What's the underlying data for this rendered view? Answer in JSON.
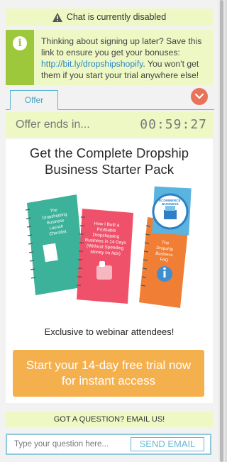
{
  "banner": {
    "text": "Chat is currently disabled",
    "icon": "warning-icon"
  },
  "notice": {
    "icon": "info-icon",
    "text_before": "Thinking about signing up later? Save this link to ensure you get your bonuses: ",
    "link": "http://bit.ly/dropshipshopify",
    "text_after": ". You won't get them if you start your trial anywhere else!"
  },
  "tabs": {
    "offer": "Offer"
  },
  "countdown": {
    "label": "Offer ends in...",
    "time": "00:59:27"
  },
  "offer": {
    "headline_line1": "Get the Complete Dropship",
    "headline_line2": "Business Starter Pack",
    "exclusive": "Exclusive to webinar attendees!",
    "cta_line1": "Start your 14-day free trial now",
    "cta_line2": "for instant access",
    "books": {
      "book1": [
        "The",
        "Dropshipping",
        "Business",
        "Launch",
        "Checklist"
      ],
      "book2": [
        "How I Built a",
        "Profitable",
        "Dropshipping",
        "Business in 14 Days",
        "(Without Spending",
        "Money on Ads)"
      ],
      "book3": [
        "The",
        "Dropship",
        "Business",
        "FAQ"
      ],
      "book4": [
        "ECOMMERCE",
        "BUSINESS"
      ]
    }
  },
  "question": {
    "header": "GOT A QUESTION? EMAIL US!",
    "placeholder": "Type your question here...",
    "send_label": "SEND EMAIL"
  },
  "colors": {
    "accent_green": "#9ec83b",
    "panel_yellow": "#eef8c4",
    "cta_orange": "#f5b04e",
    "tab_blue": "#5bb6cf",
    "collapse_red": "#e8735b"
  }
}
